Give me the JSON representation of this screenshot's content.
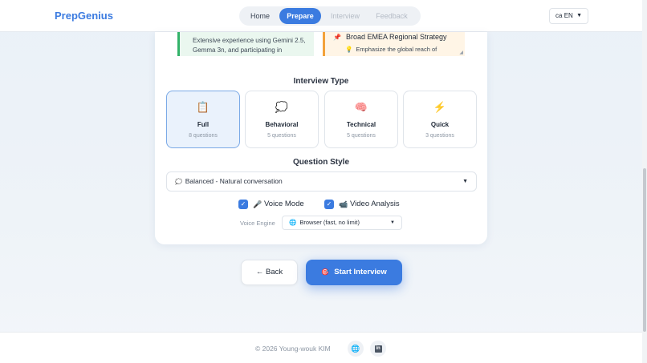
{
  "header": {
    "logo": "PrepGenius",
    "nav": [
      {
        "label": "Home"
      },
      {
        "label": "Prepare"
      },
      {
        "label": "Interview"
      },
      {
        "label": "Feedback"
      }
    ],
    "language": "EN",
    "language_prefix": "ca"
  },
  "strengths": {
    "text": "Extensive experience using Gemini 2.5, Gemma 3n, and participating in"
  },
  "tips": {
    "title": "Broad EMEA Regional Strategy",
    "desc": "Emphasize the global reach of"
  },
  "interview_type": {
    "title": "Interview Type",
    "options": [
      {
        "name": "Full",
        "count": "8 questions",
        "icon": "clipboard-icon",
        "glyph": "📋"
      },
      {
        "name": "Behavioral",
        "count": "5 questions",
        "icon": "speech-bubble-icon",
        "glyph": "💭"
      },
      {
        "name": "Technical",
        "count": "5 questions",
        "icon": "brain-icon",
        "glyph": "🧠"
      },
      {
        "name": "Quick",
        "count": "3 questions",
        "icon": "lightning-icon",
        "glyph": "⚡"
      }
    ],
    "selected": "Full"
  },
  "question_style": {
    "title": "Question Style",
    "value": "Balanced - Natural conversation"
  },
  "toggles": {
    "voice_mode": "Voice Mode",
    "video_analysis": "Video Analysis"
  },
  "voice_engine": {
    "label": "Voice Engine",
    "value": "Browser (fast, no limit)"
  },
  "actions": {
    "back": "← Back",
    "start": "Start Interview"
  },
  "footer": {
    "copyright": "© 2026 Young-wouk KIM",
    "linkedin": "in"
  },
  "colors": {
    "accent": "#3b7be0",
    "strengths_border": "#34b36a",
    "tips_border": "#f3a23b"
  }
}
